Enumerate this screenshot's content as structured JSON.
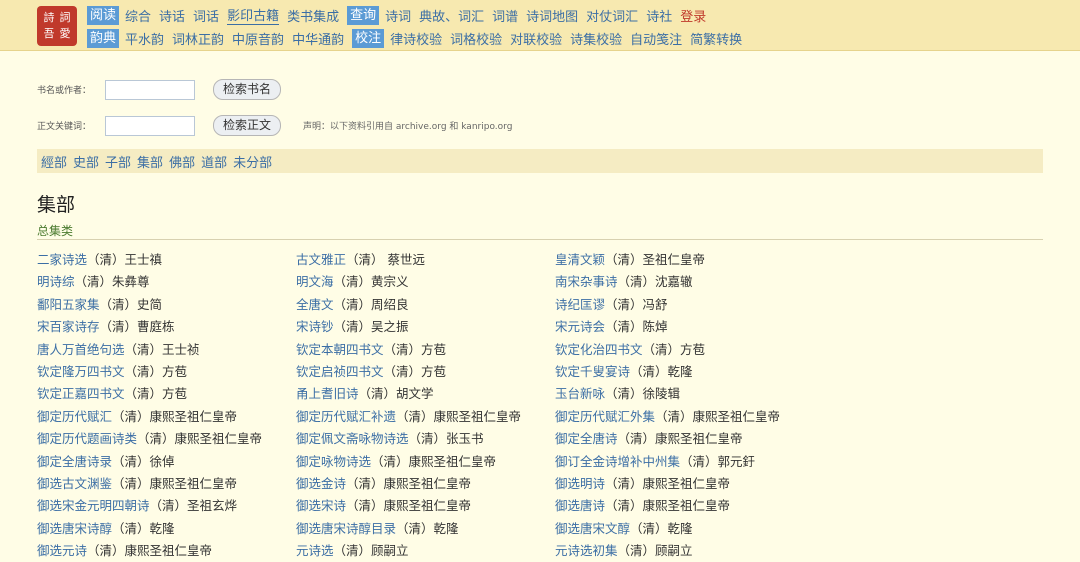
{
  "logo": {
    "text": [
      "詩",
      "詞",
      "吾",
      "愛"
    ]
  },
  "nav": {
    "row1_tag": "阅读",
    "row1": [
      "综合",
      "诗话",
      "词话",
      "影印古籍",
      "类书集成"
    ],
    "row1_tag2": "查询",
    "row1b": [
      "诗词",
      "典故、词汇",
      "词谱",
      "诗词地图",
      "对仗词汇",
      "诗社"
    ],
    "login": "登录",
    "row2_tag": "韵典",
    "row2": [
      "平水韵",
      "词林正韵",
      "中原音韵",
      "中华通韵"
    ],
    "row2_tag2": "校注",
    "row2b": [
      "律诗校验",
      "词格校验",
      "对联校验",
      "诗集校验",
      "自动笺注",
      "简繁转换"
    ]
  },
  "search": {
    "label1": "书名或作者：",
    "btn1": "检索书名",
    "label2": "正文关键词：",
    "btn2": "检索正文",
    "notice": "声明：以下资料引用自 archive.org 和 kanripo.org"
  },
  "categories": [
    "經部",
    "史部",
    "子部",
    "集部",
    "佛部",
    "道部",
    "未分部"
  ],
  "section": {
    "title": "集部",
    "subsection": "总集类"
  },
  "books": [
    {
      "title": "二家诗选",
      "author": "（清）王士禛"
    },
    {
      "title": "古文雅正",
      "author": "（清） 蔡世远"
    },
    {
      "title": "皇清文颖",
      "author": "（清）圣祖仁皇帝"
    },
    {
      "title": "明诗综",
      "author": "（清）朱彝尊"
    },
    {
      "title": "明文海",
      "author": "（清）黄宗义"
    },
    {
      "title": "南宋杂事诗",
      "author": "（清）沈嘉辙"
    },
    {
      "title": "鄱阳五家集",
      "author": "（清）史简"
    },
    {
      "title": "全唐文",
      "author": "（清）周绍良"
    },
    {
      "title": "诗纪匡谬",
      "author": "（清）冯舒"
    },
    {
      "title": "宋百家诗存",
      "author": "（清）曹庭栋"
    },
    {
      "title": "宋诗钞",
      "author": "（清）吴之振"
    },
    {
      "title": "宋元诗会",
      "author": "（清）陈焯"
    },
    {
      "title": "唐人万首绝句选",
      "author": "（清）王士祯"
    },
    {
      "title": "钦定本朝四书文",
      "author": "（清）方苞"
    },
    {
      "title": "钦定化治四书文",
      "author": "（清）方苞"
    },
    {
      "title": "钦定隆万四书文",
      "author": "（清）方苞"
    },
    {
      "title": "钦定启祯四书文",
      "author": "（清）方苞"
    },
    {
      "title": "钦定千叟宴诗",
      "author": "（清）乾隆"
    },
    {
      "title": "钦定正嘉四书文",
      "author": "（清）方苞"
    },
    {
      "title": "甬上耆旧诗",
      "author": "（清）胡文学"
    },
    {
      "title": "玉台新咏",
      "author": "（清）徐陵辑"
    },
    {
      "title": "御定历代赋汇",
      "author": "（清）康熙圣祖仁皇帝"
    },
    {
      "title": "御定历代赋汇补遗",
      "author": "（清）康熙圣祖仁皇帝"
    },
    {
      "title": "御定历代赋汇外集",
      "author": "（清）康熙圣祖仁皇帝"
    },
    {
      "title": "御定历代题画诗类",
      "author": "（清）康熙圣祖仁皇帝"
    },
    {
      "title": "御定佩文斋咏物诗选",
      "author": "（清）张玉书"
    },
    {
      "title": "御定全唐诗",
      "author": "（清）康熙圣祖仁皇帝"
    },
    {
      "title": "御定全唐诗录",
      "author": "（清）徐倬"
    },
    {
      "title": "御定咏物诗选",
      "author": "（清）康熙圣祖仁皇帝"
    },
    {
      "title": "御订全金诗增补中州集",
      "author": "（清）郭元釪"
    },
    {
      "title": "御选古文渊鉴",
      "author": "（清）康熙圣祖仁皇帝"
    },
    {
      "title": "御选金诗",
      "author": "（清）康熙圣祖仁皇帝"
    },
    {
      "title": "御选明诗",
      "author": "（清）康熙圣祖仁皇帝"
    },
    {
      "title": "御选宋金元明四朝诗",
      "author": "（清）圣祖玄烨"
    },
    {
      "title": "御选宋诗",
      "author": "（清）康熙圣祖仁皇帝"
    },
    {
      "title": "御选唐诗",
      "author": "（清）康熙圣祖仁皇帝"
    },
    {
      "title": "御选唐宋诗醇",
      "author": "（清）乾隆"
    },
    {
      "title": "御选唐宋诗醇目录",
      "author": "（清）乾隆"
    },
    {
      "title": "御选唐宋文醇",
      "author": "（清）乾隆"
    },
    {
      "title": "御选元诗",
      "author": "（清）康熙圣祖仁皇帝"
    },
    {
      "title": "元诗选",
      "author": "（清）顾嗣立"
    },
    {
      "title": "元诗选初集",
      "author": "（清）顾嗣立"
    }
  ]
}
